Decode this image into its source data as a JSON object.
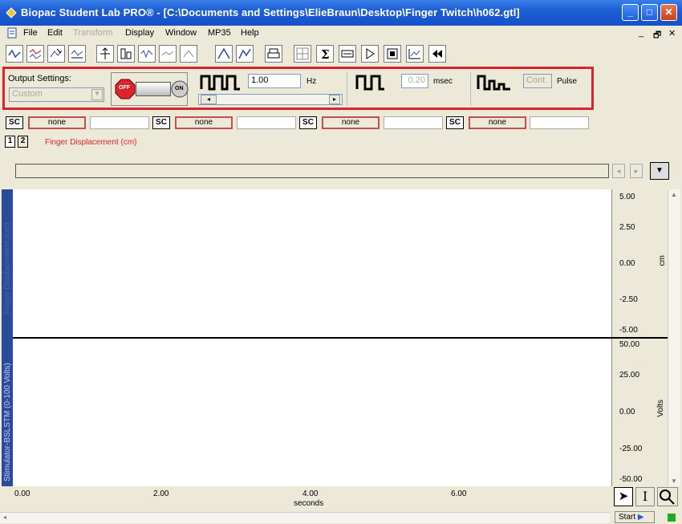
{
  "window": {
    "title": "Biopac Student Lab PRO® - [C:\\Documents and Settings\\ElieBraun\\Desktop\\Finger Twitch\\h062.gtl]",
    "minimize": "_",
    "maximize": "□",
    "close": "✕"
  },
  "menubar": {
    "items": [
      "File",
      "Edit",
      "Transform",
      "Display",
      "Window",
      "MP35",
      "Help"
    ],
    "mdi_controls": [
      "_",
      "🗗",
      "✕"
    ]
  },
  "toolbar": {
    "icons": [
      "waveform-icon",
      "overlap-icon",
      "edit-icon",
      "stack-icon",
      "scale-icon",
      "grid-icon",
      "autoscale-icon",
      "overlay-icon",
      "horizontal-icon",
      "find-peak-icon",
      "auto-find-icon",
      "print-icon",
      "grid-toggle-icon",
      "sigma-icon",
      "journal-icon",
      "marker-icon",
      "preferences-icon",
      "chart-icon",
      "rewind-icon"
    ]
  },
  "output_settings": {
    "label": "Output Settings:",
    "preset_value": "Custom",
    "off_label": "OFF",
    "on_label": "ON",
    "frequency_value": "1.00",
    "frequency_unit": "Hz",
    "pulse_width_value": "0.20",
    "pulse_width_unit": "msec",
    "pulse_mode_value": "Cont.",
    "pulse_mode_label": "Pulse"
  },
  "channels": {
    "sc_label": "SC",
    "slots": [
      "none",
      "none",
      "none",
      "none"
    ],
    "tabs": [
      "1",
      "2"
    ],
    "active_channel_label": "Finger Displacement (cm)"
  },
  "plot": {
    "top": {
      "label": "Finger Displacement (cm)",
      "unit": "cm",
      "ticks": [
        "5.00",
        "2.50",
        "0.00",
        "-2.50",
        "-5.00"
      ]
    },
    "bottom": {
      "label": "Stimulator-BSLSTM (0-100 Volts)",
      "unit": "Volts",
      "ticks": [
        "50.00",
        "25.00",
        "0.00",
        "-25.00",
        "-50.00"
      ]
    },
    "x_ticks": [
      "0.00",
      "2.00",
      "4.00",
      "6.00"
    ],
    "x_unit": "seconds"
  },
  "status": {
    "start_label": "Start"
  }
}
